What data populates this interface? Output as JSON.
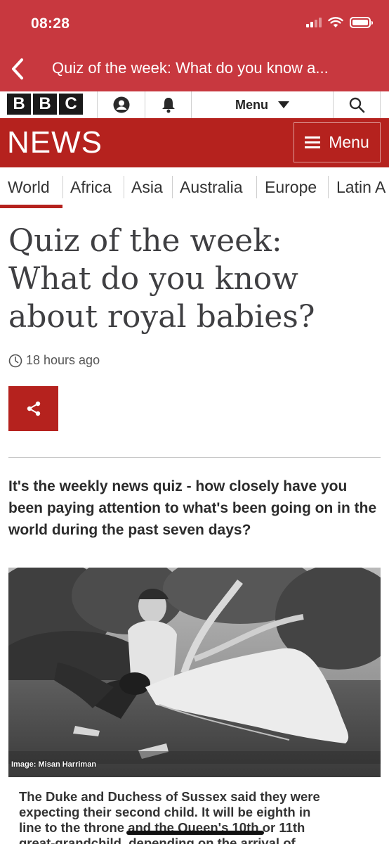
{
  "status_bar": {
    "time": "08:28"
  },
  "app_header": {
    "title": "Quiz of the week: What do you know a..."
  },
  "masthead": {
    "logo_letters": [
      "B",
      "B",
      "C"
    ],
    "menu_label": "Menu"
  },
  "news_banner": {
    "title": "NEWS",
    "menu_label": "Menu",
    "background_color": "#b5221e"
  },
  "region_nav": {
    "items": [
      "World",
      "Africa",
      "Asia",
      "Australia",
      "Europe",
      "Latin A"
    ],
    "active": "World"
  },
  "article": {
    "headline_lines": [
      "Quiz of the week:",
      "What do you know",
      "about royal babies?"
    ],
    "timestamp": "18 hours ago",
    "intro": "It's the weekly news quiz - how closely have you been paying attention to what's been going on in the world during the past seven days?",
    "image_credit": "Image: Misan Harriman",
    "caption_lines": [
      "The Duke and Duchess of Sussex said they were",
      "expecting their second child. It will be eighth in",
      "line to the throne and the Queen's 10th or 11th",
      "great-grandchild, depending on the arrival of"
    ]
  },
  "colors": {
    "status_bar": "#c8383f",
    "brand_red": "#b5221e",
    "headline_text": "#3f3f42"
  },
  "icons": {
    "back": "chevron-left-icon",
    "account": "account-icon",
    "notifications": "bell-icon",
    "menu_dropdown": "caret-down-icon",
    "search": "search-icon",
    "hamburger": "hamburger-icon",
    "clock": "clock-icon",
    "share": "share-icon"
  }
}
